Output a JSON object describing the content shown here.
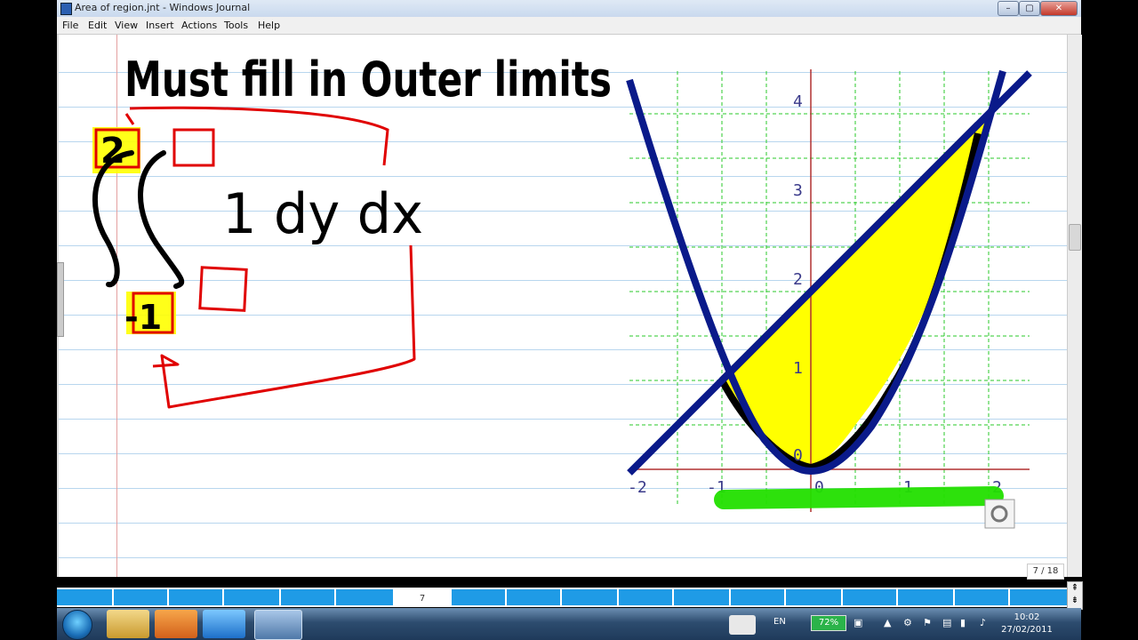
{
  "window": {
    "title": "Area of region.jnt - Windows Journal",
    "controls": {
      "minimize": "–",
      "maximize": "▢",
      "close": "✕"
    }
  },
  "menu": [
    "File",
    "Edit",
    "View",
    "Insert",
    "Actions",
    "Tools",
    "Help"
  ],
  "note": {
    "heading": "Must fill in Outer limits",
    "integrand": "1 dy dx",
    "upper_limit": "2",
    "lower_limit": "-1"
  },
  "graph": {
    "x_ticks": [
      "-2",
      "-1",
      "0",
      "1",
      "2"
    ],
    "y_ticks": [
      "0",
      "1",
      "2",
      "3",
      "4"
    ]
  },
  "page_counter": "7 / 18",
  "current_page_tab": "7",
  "taskbar": {
    "language": "EN",
    "battery": "72%",
    "time": "10:02",
    "date": "27/02/2011"
  },
  "colors": {
    "ink_black": "#000000",
    "ink_red": "#e00000",
    "highlight_yellow": "#ffff00",
    "highlight_green": "#22e000",
    "curve_blue": "#0a1a8a",
    "grid_green": "#28c828",
    "tab_blue": "#1f9be6"
  }
}
